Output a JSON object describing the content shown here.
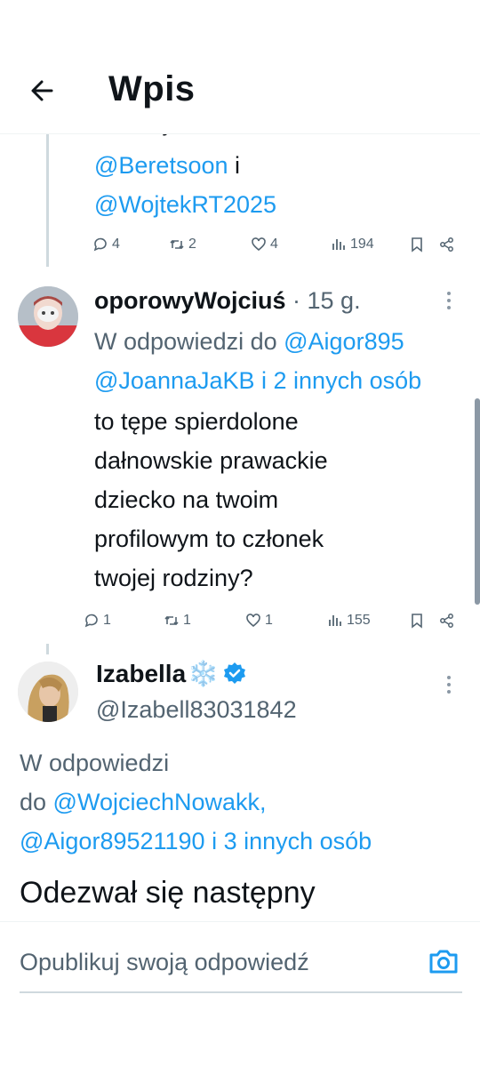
{
  "header": {
    "title": "Wpis",
    "back_icon": "arrow-left-icon"
  },
  "prev_tweet": {
    "cut_text": "uważaj na te konta:",
    "mention_1": "@Beretsoon",
    "joiner": " i",
    "mention_2": "@WojtekRT2025",
    "replies": "4",
    "retweets": "2",
    "likes": "4",
    "views": "194"
  },
  "tweet_1": {
    "name": "oporowyWojciuś",
    "sep": " · ",
    "time": "15 g.",
    "reply_prefix": "W odpowiedzi do ",
    "reply_mention_1": "@Aigor895",
    "reply_mention_2": "@JoannaJaKB i 2 innych osób",
    "lines": [
      "to tępe spierdolone",
      "dałnowskie prawackie",
      "dziecko na twoim",
      "profilowym to członek",
      "twojej rodziny?"
    ],
    "replies": "1",
    "retweets": "1",
    "likes": "1",
    "views": "155"
  },
  "tweet_2": {
    "name": "Izabella",
    "emoji": "❄️",
    "handle": "@Izabell83031842",
    "reply_line_1": "W odpowiedzi",
    "reply_do": "do ",
    "reply_mention_1": "@WojciechNowakk,",
    "reply_mention_2": "@Aigor89521190 i 3 innych osób",
    "text": "Odezwał się następny"
  },
  "reply_bar": {
    "placeholder": "Opublikuj swoją odpowiedź",
    "camera_icon": "camera-icon"
  },
  "colors": {
    "link": "#1d9bf0",
    "muted": "#536471",
    "verified": "#1d9bf0"
  }
}
